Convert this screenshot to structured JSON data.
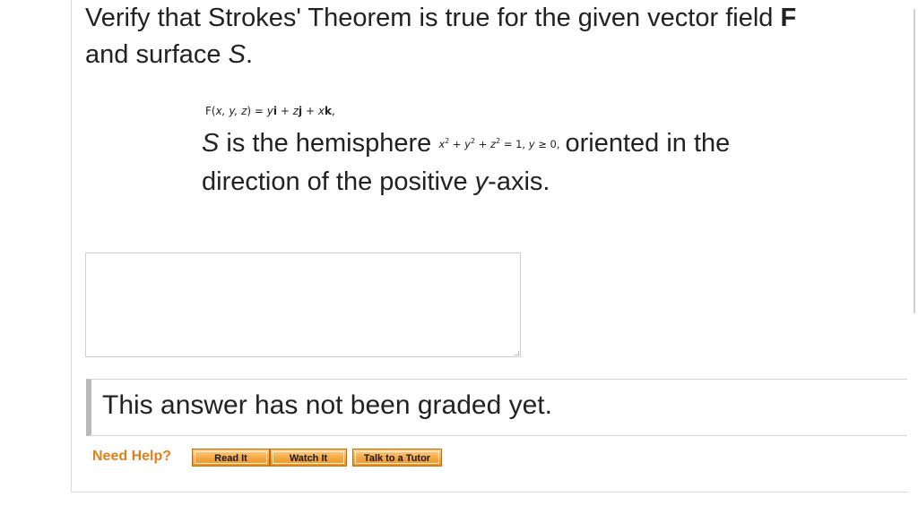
{
  "question": {
    "line1_prefix": "Verify that Strokes' Theorem is true for the given vector field ",
    "line1_bold": "F",
    "line2_prefix": "and surface ",
    "line2_italic": "S",
    "line2_suffix": "."
  },
  "vector_field": {
    "lhs": "F(",
    "args": "x, y, z",
    "eq": ") = ",
    "term1_var": "y",
    "term1_unit": "i",
    "plus1": " + ",
    "term2_var": "z",
    "term2_unit": "j",
    "plus2": " + ",
    "term3_var": "x",
    "term3_unit": "k",
    "end": ","
  },
  "surface": {
    "italic_s": "S",
    "text_before": " is the hemisphere",
    "equation": {
      "x": "x",
      "y": "y",
      "z": "z",
      "exp": "2",
      "plus": " + ",
      "eq_rhs": " = 1, ",
      "cond_var": "y",
      "cond_rest": " ≥ 0,"
    },
    "text_after": "oriented in the",
    "line2_prefix": "direction of the positive ",
    "line2_italic": "y",
    "line2_suffix": "-axis."
  },
  "answer_box": {
    "value": ""
  },
  "grade_status": "This answer has not been graded yet.",
  "help": {
    "label": "Need Help?",
    "read_it": "Read It",
    "watch_it": "Watch It",
    "talk_to_tutor": "Talk to a Tutor"
  },
  "colors": {
    "help_label": "#e07f1a",
    "button_fill": "#f4a640",
    "button_border": "#c26a08",
    "grade_bar": "#b9b9b9"
  }
}
